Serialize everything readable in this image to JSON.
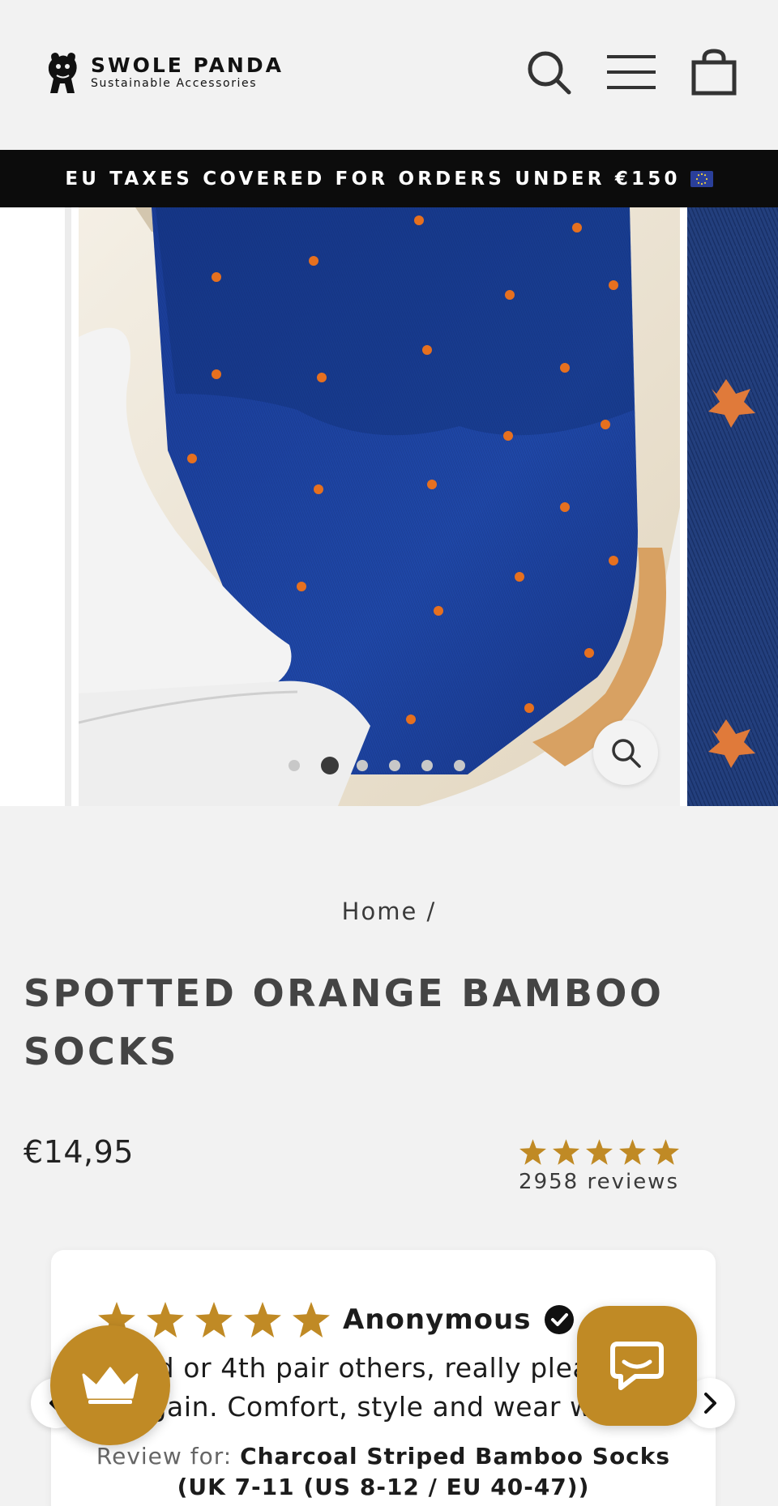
{
  "brand": {
    "name": "SWOLE PANDA",
    "tagline": "Sustainable Accessories"
  },
  "header_icons": [
    "search-icon",
    "hamburger-menu-icon",
    "shopping-bag-icon"
  ],
  "announcement": {
    "text": "EU TAXES COVERED FOR ORDERS UNDER €150"
  },
  "gallery": {
    "slide_count": 6,
    "active_slide": 2,
    "zoom_icon": "zoom-magnifier-icon"
  },
  "breadcrumb": {
    "home": "Home",
    "separator": "/"
  },
  "product": {
    "title": "SPOTTED ORANGE BAMBOO SOCKS",
    "price": "€14,95",
    "rating_stars": 5,
    "reviews_label": "2958 reviews"
  },
  "review": {
    "stars": 5,
    "author": "Anonymous",
    "text_line1": "3rd or 4th pair others, really pleased",
    "text_line2": "again. Comfort, style and wear well.",
    "for_label": "Review for:",
    "for_product_line1": "Charcoal Striped Bamboo Socks",
    "for_product_line2": "(UK 7-11 (US 8-12 / EU 40-47))"
  },
  "colors": {
    "background": "#f2f2f2",
    "announcement_bg": "#0c0c0c",
    "accent_gold": "#c08a25",
    "sock_blue": "#1b3f94",
    "sock_orange": "#e6701f",
    "text_dark": "#3a3a3a"
  }
}
